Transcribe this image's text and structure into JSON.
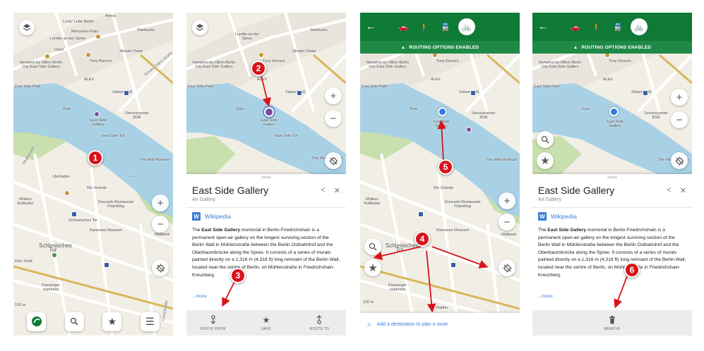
{
  "map_labels": {
    "arena": "Arena",
    "lovin": "Lovin' Lotte Berlin",
    "mercedes": "Mercedes-Platz",
    "starbucks": "Starbucks",
    "lorette": "Lorette an der Spree",
    "ostel": "Ostel",
    "stream_tower": "Stream Tower",
    "hampton": "Hampton by Hilton Berlin City East Side Gallery",
    "tony": "Tony Roma's",
    "alex": "ALEX",
    "zalando": "Zalando SE",
    "tamara": "Tamara-Danz-Straße",
    "eastside_park": "East Side Park",
    "zola": "Zola",
    "gallery": "East Side Gallery",
    "serviceenter": "Servicecenter BSR",
    "eastside_tor": "East Side Tor",
    "wall_museum": "The Wall Museum",
    "spree": "Spree",
    "pfuelstr": "Pfuelstraße",
    "ufer": "Uferhallen",
    "rio": "Rio Grande",
    "doncarlo": "Doncarlo Restaurant Flutrelling",
    "mollers": "Möllers Kottbuller",
    "schles_str": "Schlesisches Tor",
    "ramones": "Ramones Museum",
    "wallpark": "Wallpark",
    "schles_tor": "Schlesisches Tor",
    "klez": "Klez Textil",
    "passenger": "Passenger espresso",
    "radhu": "Radhu",
    "scale": "100 m",
    "cuvry": "Cuvrystraße"
  },
  "screen1": {
    "marker": "1",
    "icons": {
      "layers": "layers-icon",
      "zoom_in": "+",
      "zoom_out": "−",
      "locate": "crosshair-off-icon"
    },
    "bottom_buttons": [
      "logo-icon",
      "search-icon",
      "star-icon",
      "menu-icon"
    ]
  },
  "screen2": {
    "markers": [
      "2",
      "3"
    ],
    "place_title": "East Side Gallery",
    "place_type": "Art Gallery",
    "wiki_label": "Wikipedia",
    "description_parts": {
      "p1": "The ",
      "bold": "East Side Gallery",
      "p2": " memorial in Berlin-Friedrichshain is a permanent open-air gallery on the longest surviving section of the Berlin Wall in Mühlenstraße between the Berlin Ostbahnhof and the Oberbaumbrücke along the Spree. It consists of a series of murals painted directly on a 1,316 m (4,318 ft) long remnant of the Berlin Wall, located near the centre of Berlin, on Mühlenstraße in Friedrichshain-Kreuzberg."
    },
    "more": "...more",
    "actions": [
      {
        "icon": "route-from-icon",
        "label": "ROUTE FROM"
      },
      {
        "icon": "save-star-icon",
        "label": "SAVE"
      },
      {
        "icon": "route-to-icon",
        "label": "ROUTE TO"
      }
    ]
  },
  "screen3": {
    "markers": [
      "4",
      "5"
    ],
    "routing_banner": "ROUTING OPTIONS ENABLED",
    "modes": [
      "car-icon",
      "walk-icon",
      "transit-icon",
      "bike-icon"
    ],
    "active_mode": "bike-icon",
    "destination_prompt": "Add a destination to plan a route"
  },
  "screen4": {
    "marker": "6",
    "routing_banner": "ROUTING OPTIONS ENABLED",
    "place_title": "East Side Gallery",
    "place_type": "Art Gallery",
    "wiki_label": "Wikipedia",
    "more": "...more",
    "action_label": "REMOVE"
  },
  "colors": {
    "route_green": "#0e7a36",
    "marker_red": "#d8141b",
    "water": "#a8d1e6",
    "park": "#c8dfae",
    "link_blue": "#3b7dd8"
  }
}
